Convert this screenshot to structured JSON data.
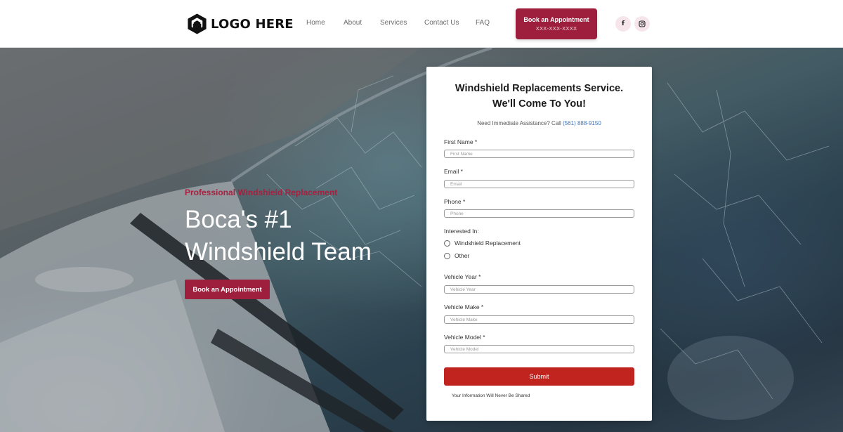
{
  "header": {
    "logo_text": "LOGO HERE",
    "nav": [
      "Home",
      "About",
      "Services",
      "Contact Us",
      "FAQ"
    ],
    "cta": {
      "label": "Book an Appointment",
      "phone": "XXX-XXX-XXXX"
    },
    "social": {
      "facebook_glyph": "f",
      "icons": [
        "facebook-icon",
        "instagram-icon"
      ]
    }
  },
  "hero": {
    "kicker": "Professional Windshield Replacement",
    "title": "Boca's #1 Windshield Team",
    "button": "Book an Appointment"
  },
  "form": {
    "title": "Windshield Replacements Service. We'll Come To You!",
    "assist_text": "Need Immediate Assistance? Call",
    "assist_phone": "(561) 888-9150",
    "fields": {
      "first_name": {
        "label": "First Name *",
        "placeholder": "First Name"
      },
      "email": {
        "label": "Email *",
        "placeholder": "Email"
      },
      "phone": {
        "label": "Phone *",
        "placeholder": "Phone"
      },
      "vehicle_year": {
        "label": "Vehicle Year *",
        "placeholder": "Vehicle Year"
      },
      "vehicle_make": {
        "label": "Vehicle Make *",
        "placeholder": "Vehicle Make"
      },
      "vehicle_model": {
        "label": "Vehicle Model *",
        "placeholder": "Vehicle Model"
      }
    },
    "interest_label": "Interested In:",
    "options": [
      "Windshield Replacement",
      "Other"
    ],
    "submit": "Submit",
    "privacy": "Your Information Will Never Be Shared"
  },
  "colors": {
    "brand": "#9e1f3d",
    "submit": "#c1231f",
    "link": "#3d74b8"
  }
}
